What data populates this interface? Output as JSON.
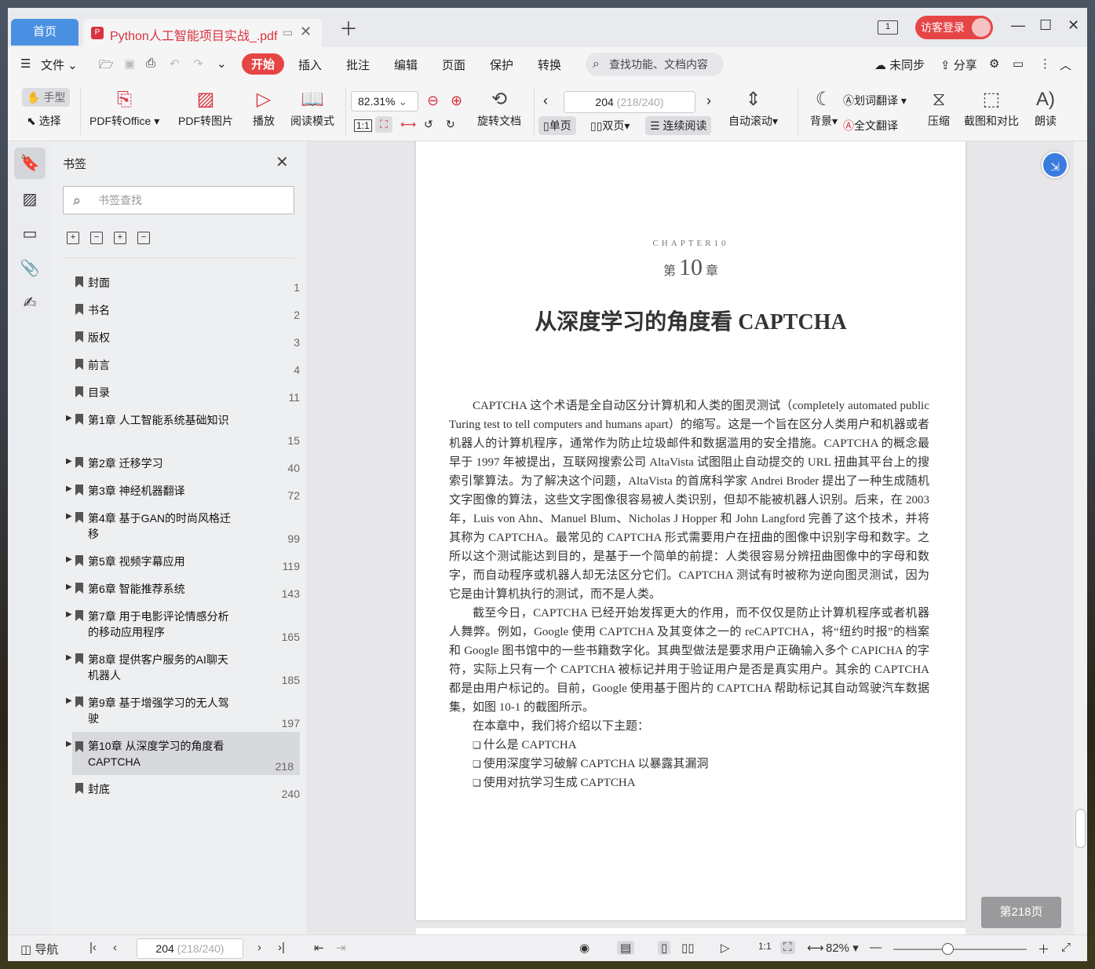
{
  "titlebar": {
    "home_tab": "首页",
    "doc_tab": "Python人工智能项目实战_.pdf",
    "reader_icon": "1",
    "login": "访客登录"
  },
  "menubar": {
    "file": "文件",
    "tabs": [
      "开始",
      "插入",
      "批注",
      "编辑",
      "页面",
      "保护",
      "转换"
    ],
    "search": "查找功能、文档内容",
    "sync": "未同步",
    "share": "分享"
  },
  "ribbon": {
    "hand": "手型",
    "select": "选择",
    "pdf_office": "PDF转Office",
    "pdf_image": "PDF转图片",
    "play": "播放",
    "read_mode": "阅读模式",
    "zoom": "82.31%",
    "rotate": "旋转文档",
    "page_current": "204",
    "page_total": "(218/240)",
    "single": "单页",
    "double": "双页",
    "continuous": "连续阅读",
    "autoscroll": "自动滚动",
    "background": "背景",
    "word_translate": "划词翻译",
    "full_translate": "全文翻译",
    "compress": "压缩",
    "screenshot": "截图和对比",
    "read_aloud": "朗读"
  },
  "panel": {
    "title": "书签",
    "search_placeholder": "书签查找",
    "bookmarks": [
      {
        "label": "封面",
        "page": "1"
      },
      {
        "label": "书名",
        "page": "2"
      },
      {
        "label": "版权",
        "page": "3"
      },
      {
        "label": "前言",
        "page": "4"
      },
      {
        "label": "目录",
        "page": "11"
      },
      {
        "label": "第1章 人工智能系统基础知识",
        "page": "15"
      },
      {
        "label": "第2章 迁移学习",
        "page": "40"
      },
      {
        "label": "第3章 神经机器翻译",
        "page": "72"
      },
      {
        "label": "第4章 基于GAN的时尚风格迁移",
        "page": "99"
      },
      {
        "label": "第5章 视频字幕应用",
        "page": "119"
      },
      {
        "label": "第6章 智能推荐系统",
        "page": "143"
      },
      {
        "label": "第7章 用于电影评论情感分析的移动应用程序",
        "page": "165"
      },
      {
        "label": "第8章 提供客户服务的AI聊天机器人",
        "page": "185"
      },
      {
        "label": "第9章 基于增强学习的无人驾驶",
        "page": "197"
      },
      {
        "label": "第10章 从深度学习的角度看CAPTCHA",
        "page": "218"
      },
      {
        "label": "封底",
        "page": "240"
      }
    ]
  },
  "page": {
    "chapter_en": "CHAPTER10",
    "chapter_prefix": "第",
    "chapter_num": "10",
    "chapter_suffix": "章",
    "title": "从深度学习的角度看 CAPTCHA",
    "p1": "CAPTCHA 这个术语是全自动区分计算机和人类的图灵测试（completely automated public Turing test to tell computers and humans apart）的缩写。这是一个旨在区分人类用户和机器或者机器人的计算机程序，通常作为防止垃圾邮件和数据滥用的安全措施。CAPTCHA 的概念最早于 1997 年被提出，互联网搜索公司 AltaVista 试图阻止自动提交的 URL 扭曲其平台上的搜索引擎算法。为了解决这个问题，AltaVista 的首席科学家 Andrei Broder 提出了一种生成随机文字图像的算法，这些文字图像很容易被人类识别，但却不能被机器人识别。后来，在 2003 年，Luis von Ahn、Manuel Blum、Nicholas J Hopper 和 John Langford 完善了这个技术，并将其称为 CAPTCHA。最常见的 CAPTCHA 形式需要用户在扭曲的图像中识别字母和数字。之所以这个测试能达到目的，是基于一个简单的前提：人类很容易分辨扭曲图像中的字母和数字，而自动程序或机器人却无法区分它们。CAPTCHA 测试有时被称为逆向图灵测试，因为它是由计算机执行的测试，而不是人类。",
    "p2": "截至今日，CAPTCHA 已经开始发挥更大的作用，而不仅仅是防止计算机程序或者机器人舞弊。例如，Google 使用 CAPTCHA 及其变体之一的 reCAPTCHA，将“纽约时报”的档案和 Google 图书馆中的一些书籍数字化。其典型做法是要求用户正确输入多个 CAPICHA 的字符，实际上只有一个 CAPTCHA 被标记并用于验证用户是否是真实用户。其余的 CAPTCHA 都是由用户标记的。目前，Google 使用基于图片的 CAPTCHA 帮助标记其自动驾驶汽车数据集，如图 10-1 的截图所示。",
    "p3": "在本章中，我们将介绍以下主题：",
    "topics": [
      "什么是 CAPTCHA",
      "使用深度学习破解 CAPTCHA 以暴露其漏洞",
      "使用对抗学习生成 CAPTCHA"
    ]
  },
  "page_badge": "第218页",
  "statusbar": {
    "nav": "导航",
    "page_current": "204",
    "page_total": "(218/240)",
    "zoom": "82%"
  }
}
